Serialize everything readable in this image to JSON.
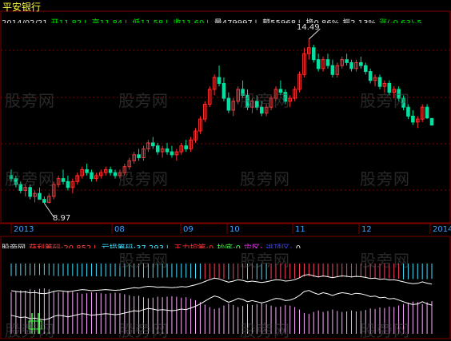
{
  "stock_name": "平安银行",
  "quote_line": [
    {
      "text": "2014/02/21",
      "color": "#e0e0e0"
    },
    {
      "text": "开11.82↓",
      "color": "#00e000"
    },
    {
      "text": "高11.84↓",
      "color": "#00e000"
    },
    {
      "text": "低11.58↓",
      "color": "#00e000"
    },
    {
      "text": "收11.60↓",
      "color": "#00e000"
    },
    {
      "text": "量479997↓",
      "color": "#e0e0e0"
    },
    {
      "text": "额55968↓",
      "color": "#e0e0e0"
    },
    {
      "text": "换0.86%",
      "color": "#e0e0e0"
    },
    {
      "text": "振2.13%",
      "color": "#e0e0e0"
    },
    {
      "text": "涨(-0.63)-5.",
      "color": "#00e000"
    }
  ],
  "price_annotations": {
    "high_label": "14.49",
    "low_label": "8.97"
  },
  "month_labels": [
    "2013",
    "08",
    "09",
    "10",
    "11",
    "12",
    "2014"
  ],
  "indicator_line": [
    {
      "text": "股旁网",
      "color": "#e0e0e0"
    },
    {
      "text": "获利筹码:20.852↓",
      "color": "#ff4040"
    },
    {
      "text": "亏损筹码:37.293↓",
      "color": "#40e0ff"
    },
    {
      "text": "王力控筹:0",
      "color": "#ff3030"
    },
    {
      "text": "抄底:0",
      "color": "#40ff40"
    },
    {
      "text": "灾区:",
      "color": "#ff40ff"
    },
    {
      "text": "逃顶区:",
      "color": "#4040ff"
    },
    {
      "text": "0",
      "color": "#e0e0e0"
    }
  ],
  "watermark_text": "股旁网",
  "colors": {
    "up_candle": "#ff3030",
    "down_candle": "#00e0a0",
    "grid": "#800000",
    "loss_bar": "#40e0ff",
    "profit_bar": "#ff4060",
    "lower_bar": "#ffb0ff",
    "curve": "#ffffff"
  },
  "chart_data": {
    "type": "candlestick",
    "title": "平安银行",
    "ylim": [
      8.5,
      15.0
    ],
    "high_marker": 14.49,
    "low_marker": 8.97,
    "candles": [
      [
        9.9,
        10.1,
        9.7,
        9.8
      ],
      [
        9.8,
        9.9,
        9.5,
        9.6
      ],
      [
        9.6,
        9.7,
        9.3,
        9.4
      ],
      [
        9.4,
        9.6,
        9.2,
        9.5
      ],
      [
        9.5,
        9.6,
        9.1,
        9.2
      ],
      [
        9.2,
        9.4,
        9.0,
        9.3
      ],
      [
        9.3,
        9.5,
        9.1,
        9.1
      ],
      [
        9.1,
        9.2,
        8.97,
        9.0
      ],
      [
        9.0,
        9.3,
        8.97,
        9.2
      ],
      [
        9.2,
        9.7,
        9.1,
        9.6
      ],
      [
        9.6,
        9.9,
        9.5,
        9.8
      ],
      [
        9.8,
        10.1,
        9.6,
        9.7
      ],
      [
        9.7,
        9.9,
        9.4,
        9.5
      ],
      [
        9.5,
        9.8,
        9.3,
        9.7
      ],
      [
        9.7,
        10.0,
        9.6,
        9.9
      ],
      [
        9.9,
        10.2,
        9.8,
        10.1
      ],
      [
        10.1,
        10.3,
        9.9,
        10.0
      ],
      [
        10.0,
        10.1,
        9.7,
        9.8
      ],
      [
        9.8,
        10.0,
        9.7,
        9.9
      ],
      [
        9.9,
        10.1,
        9.8,
        10.0
      ],
      [
        10.0,
        10.2,
        9.9,
        10.1
      ],
      [
        10.1,
        10.2,
        9.9,
        10.0
      ],
      [
        10.0,
        10.1,
        9.8,
        9.9
      ],
      [
        9.9,
        10.1,
        9.8,
        10.0
      ],
      [
        10.0,
        10.3,
        9.9,
        10.2
      ],
      [
        10.2,
        10.5,
        10.1,
        10.4
      ],
      [
        10.4,
        10.7,
        10.3,
        10.6
      ],
      [
        10.6,
        10.8,
        10.4,
        10.5
      ],
      [
        10.5,
        10.9,
        10.4,
        10.8
      ],
      [
        10.8,
        11.1,
        10.7,
        11.0
      ],
      [
        11.0,
        11.2,
        10.8,
        10.9
      ],
      [
        10.9,
        11.0,
        10.6,
        10.7
      ],
      [
        10.7,
        10.9,
        10.5,
        10.8
      ],
      [
        10.8,
        11.0,
        10.6,
        10.7
      ],
      [
        10.7,
        10.9,
        10.5,
        10.6
      ],
      [
        10.6,
        10.8,
        10.4,
        10.7
      ],
      [
        10.7,
        11.0,
        10.6,
        10.9
      ],
      [
        10.9,
        11.1,
        10.7,
        10.8
      ],
      [
        10.8,
        11.2,
        10.7,
        11.1
      ],
      [
        11.1,
        11.5,
        11.0,
        11.4
      ],
      [
        11.4,
        11.9,
        11.3,
        11.8
      ],
      [
        11.8,
        12.4,
        11.7,
        12.3
      ],
      [
        12.3,
        12.9,
        12.2,
        12.8
      ],
      [
        12.8,
        13.3,
        12.6,
        13.2
      ],
      [
        13.2,
        13.6,
        12.9,
        13.0
      ],
      [
        13.0,
        13.2,
        12.4,
        12.5
      ],
      [
        12.5,
        12.7,
        12.0,
        12.1
      ],
      [
        12.1,
        12.5,
        11.9,
        12.4
      ],
      [
        12.4,
        12.9,
        12.3,
        12.8
      ],
      [
        12.8,
        13.1,
        12.5,
        12.6
      ],
      [
        12.6,
        12.8,
        12.1,
        12.2
      ],
      [
        12.2,
        12.5,
        12.0,
        12.4
      ],
      [
        12.4,
        12.6,
        12.1,
        12.2
      ],
      [
        12.2,
        12.4,
        11.9,
        12.0
      ],
      [
        12.0,
        12.3,
        11.9,
        12.2
      ],
      [
        12.2,
        12.6,
        12.1,
        12.5
      ],
      [
        12.5,
        12.9,
        12.4,
        12.8
      ],
      [
        12.8,
        13.1,
        12.6,
        12.7
      ],
      [
        12.7,
        12.8,
        12.3,
        12.4
      ],
      [
        12.4,
        12.6,
        12.2,
        12.5
      ],
      [
        12.5,
        12.9,
        12.4,
        12.8
      ],
      [
        12.8,
        13.4,
        12.7,
        13.3
      ],
      [
        13.3,
        14.2,
        13.2,
        14.0
      ],
      [
        14.0,
        14.49,
        13.8,
        14.2
      ],
      [
        14.2,
        14.3,
        13.7,
        13.8
      ],
      [
        13.8,
        14.0,
        13.4,
        13.5
      ],
      [
        13.5,
        13.9,
        13.4,
        13.8
      ],
      [
        13.8,
        14.0,
        13.5,
        13.6
      ],
      [
        13.6,
        13.8,
        13.2,
        13.3
      ],
      [
        13.3,
        13.7,
        13.2,
        13.6
      ],
      [
        13.6,
        13.9,
        13.5,
        13.8
      ],
      [
        13.8,
        14.0,
        13.6,
        13.7
      ],
      [
        13.7,
        13.8,
        13.4,
        13.5
      ],
      [
        13.5,
        13.8,
        13.4,
        13.7
      ],
      [
        13.7,
        13.9,
        13.5,
        13.6
      ],
      [
        13.6,
        13.7,
        13.3,
        13.4
      ],
      [
        13.4,
        13.5,
        13.0,
        13.1
      ],
      [
        13.1,
        13.3,
        12.9,
        13.2
      ],
      [
        13.2,
        13.3,
        12.8,
        12.9
      ],
      [
        12.9,
        13.1,
        12.7,
        13.0
      ],
      [
        13.0,
        13.1,
        12.6,
        12.7
      ],
      [
        12.7,
        12.9,
        12.5,
        12.8
      ],
      [
        12.8,
        12.9,
        12.4,
        12.5
      ],
      [
        12.5,
        12.6,
        12.1,
        12.2
      ],
      [
        12.2,
        12.3,
        11.8,
        11.9
      ],
      [
        11.9,
        12.1,
        11.6,
        11.7
      ],
      [
        11.7,
        11.9,
        11.5,
        11.8
      ],
      [
        11.8,
        12.3,
        11.7,
        12.2
      ],
      [
        12.2,
        12.3,
        11.8,
        11.84
      ],
      [
        11.82,
        11.84,
        11.58,
        11.6
      ]
    ]
  }
}
